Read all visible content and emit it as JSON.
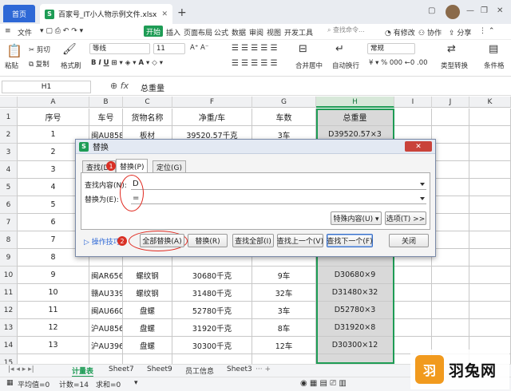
{
  "titlebar": {
    "home_tab": "首页",
    "file_tab": "百家号_IT小人物示例文件.xlsx",
    "new_tab": "+"
  },
  "menubar": {
    "file": "文件",
    "items": [
      "开始",
      "插入",
      "页面布局",
      "公式",
      "数据",
      "审阅",
      "视图",
      "开发工具"
    ],
    "search_placeholder": "查找命令...",
    "revise": "有修改",
    "collaborate": "协作",
    "share": "分享"
  },
  "toolbar": {
    "cut": "剪切",
    "copy": "复制",
    "paste": "粘贴",
    "format_painter": "格式刷",
    "font_name": "等线",
    "font_size": "11",
    "merge_center": "合并居中",
    "wrap": "自动换行",
    "number_format": "常规",
    "type_convert": "类型转换",
    "cond_format": "条件格"
  },
  "formula_bar": {
    "name_box": "H1",
    "content": "总重量"
  },
  "sheet": {
    "columns": [
      "A",
      "B",
      "C",
      "F",
      "G",
      "H",
      "I",
      "J",
      "K"
    ],
    "header_row": [
      "序号",
      "车号",
      "货物名称",
      "净重/车",
      "车数",
      "总重量"
    ],
    "rows": [
      {
        "n": "2",
        "a": "1",
        "b": "闽AU858",
        "c": "板材",
        "f": "39520.57千克",
        "g": "3车",
        "h": "D39520.57×3"
      },
      {
        "n": "3",
        "a": "2",
        "b": "",
        "c": "",
        "f": "",
        "g": "",
        "h": ""
      },
      {
        "n": "4",
        "a": "3",
        "b": "",
        "c": "",
        "f": "",
        "g": "",
        "h": ""
      },
      {
        "n": "5",
        "a": "4",
        "b": "",
        "c": "",
        "f": "",
        "g": "",
        "h": ""
      },
      {
        "n": "6",
        "a": "5",
        "b": "",
        "c": "",
        "f": "",
        "g": "",
        "h": ""
      },
      {
        "n": "7",
        "a": "6",
        "b": "",
        "c": "",
        "f": "",
        "g": "",
        "h": ""
      },
      {
        "n": "8",
        "a": "7",
        "b": "",
        "c": "",
        "f": "",
        "g": "",
        "h": ""
      },
      {
        "n": "9",
        "a": "8",
        "b": "",
        "c": "",
        "f": "",
        "g": "",
        "h": ""
      },
      {
        "n": "10",
        "a": "9",
        "b": "闽AR656",
        "c": "螺纹钢",
        "f": "30680千克",
        "g": "9车",
        "h": "D30680×9"
      },
      {
        "n": "11",
        "a": "10",
        "b": "赣AU339",
        "c": "螺纹钢",
        "f": "31480千克",
        "g": "32车",
        "h": "D31480×32"
      },
      {
        "n": "12",
        "a": "11",
        "b": "闽AU660",
        "c": "盘螺",
        "f": "52780千克",
        "g": "3车",
        "h": "D52780×3"
      },
      {
        "n": "13",
        "a": "12",
        "b": "沪AU856",
        "c": "盘螺",
        "f": "31920千克",
        "g": "8车",
        "h": "D31920×8"
      },
      {
        "n": "14",
        "a": "13",
        "b": "沪AU396",
        "c": "盘螺",
        "f": "30300千克",
        "g": "12车",
        "h": "D30300×12"
      },
      {
        "n": "15",
        "a": "",
        "b": "",
        "c": "",
        "f": "",
        "g": "",
        "h": ""
      }
    ],
    "first_row_num": "1"
  },
  "sheet_tabs": [
    "计量表",
    "Sheet7",
    "Sheet9",
    "员工信息",
    "Sheet3"
  ],
  "status": {
    "average": "平均值=0",
    "count": "计数=14",
    "sum": "求和=0"
  },
  "dialog": {
    "title": "替换",
    "tabs": [
      "查找(D)",
      "替换(P)",
      "定位(G)"
    ],
    "find_label": "查找内容(N):",
    "find_value": "D",
    "replace_label": "替换为(E):",
    "replace_value": "=",
    "special_btn": "特殊内容(U) ▾",
    "options_btn": "选项(T) >>",
    "tips_link": "操作技巧",
    "replace_all_btn": "全部替换(A)",
    "replace_btn": "替换(R)",
    "find_all_btn": "查找全部(I)",
    "find_prev_btn": "查找上一个(V)",
    "find_next_btn": "查找下一个(F)",
    "close_btn": "关闭",
    "close_x": "✕",
    "badge1": "1",
    "badge2": "2"
  },
  "watermark": {
    "text": "羽兔网"
  }
}
